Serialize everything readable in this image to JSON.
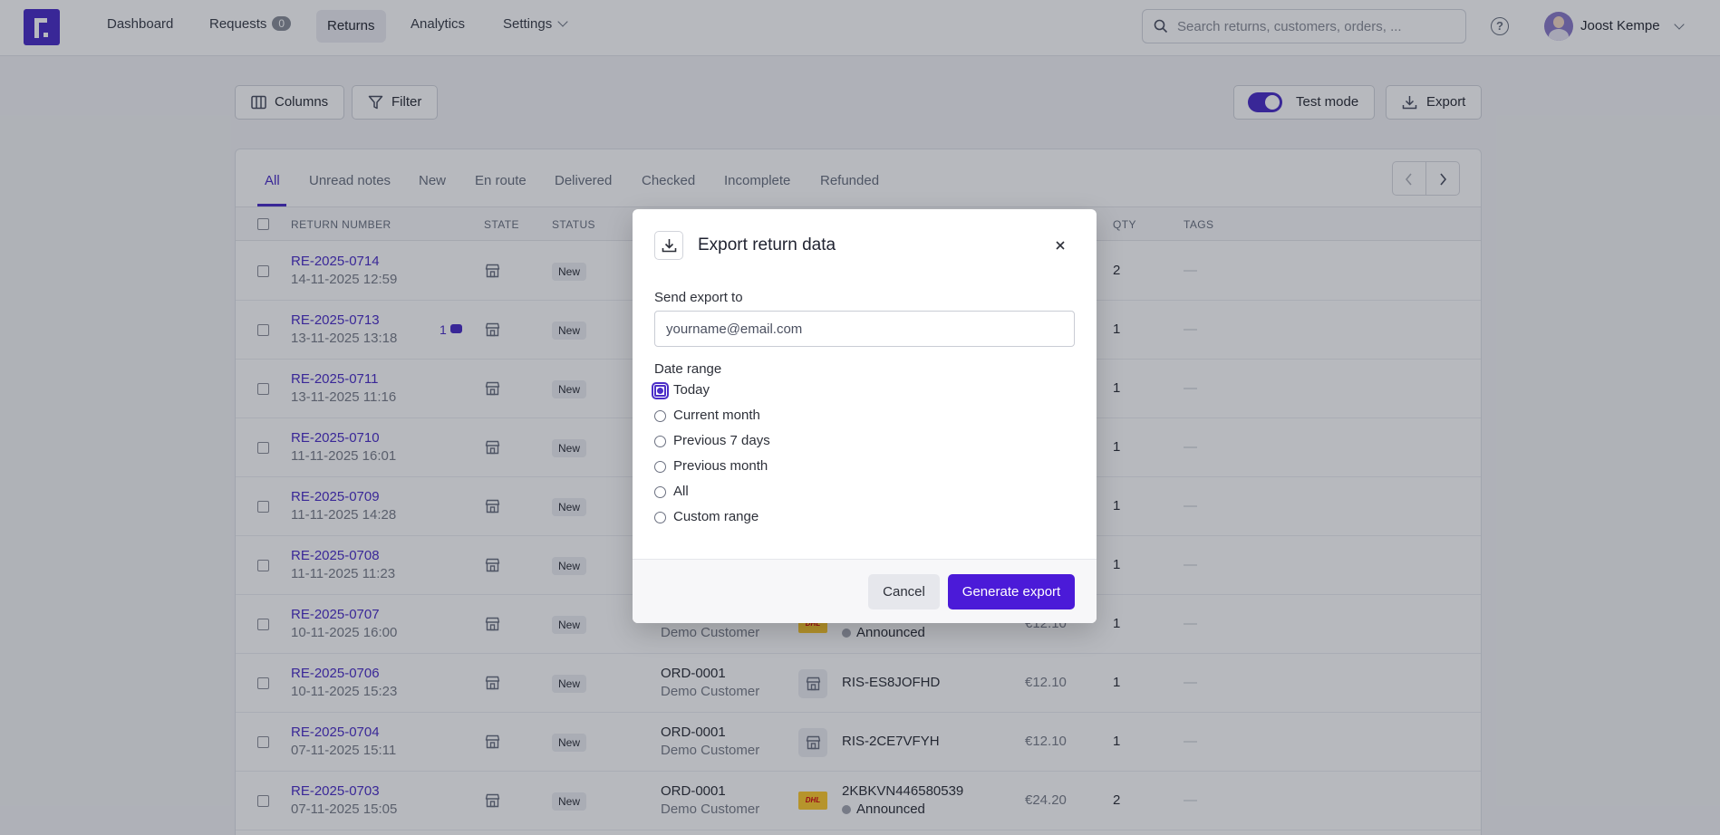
{
  "nav": {
    "items": [
      {
        "label": "Dashboard"
      },
      {
        "label": "Requests",
        "badge": "0"
      },
      {
        "label": "Returns",
        "active": true
      },
      {
        "label": "Analytics"
      },
      {
        "label": "Settings"
      }
    ],
    "search_placeholder": "Search returns, customers, orders, ...",
    "user_name": "Joost Kempe"
  },
  "toolbar": {
    "columns_label": "Columns",
    "filter_label": "Filter",
    "test_mode_label": "Test mode",
    "test_mode_on": true,
    "export_label": "Export"
  },
  "tabs": [
    "All",
    "Unread notes",
    "New",
    "En route",
    "Delivered",
    "Checked",
    "Incomplete",
    "Refunded"
  ],
  "table": {
    "headers": {
      "return_number": "RETURN NUMBER",
      "state": "STATE",
      "status": "STATUS",
      "qty": "QTY",
      "tags": "TAGS"
    },
    "rows": [
      {
        "number": "RE-2025-0714",
        "date": "14-11-2025 12:59",
        "status": "New",
        "qty": "2",
        "tags": "—"
      },
      {
        "number": "RE-2025-0713",
        "date": "13-11-2025 13:18",
        "notes": "1",
        "status": "New",
        "qty": "1",
        "tags": "—"
      },
      {
        "number": "RE-2025-0711",
        "date": "13-11-2025 11:16",
        "status": "New",
        "qty": "1",
        "tags": "—"
      },
      {
        "number": "RE-2025-0710",
        "date": "11-11-2025 16:01",
        "status": "New",
        "qty": "1",
        "tags": "—"
      },
      {
        "number": "RE-2025-0709",
        "date": "11-11-2025 14:28",
        "status": "New",
        "qty": "1",
        "tags": "—"
      },
      {
        "number": "RE-2025-0708",
        "date": "11-11-2025 11:23",
        "status": "New",
        "qty": "1",
        "tags": "—"
      },
      {
        "number": "RE-2025-0707",
        "date": "10-11-2025 16:00",
        "status": "New",
        "customer": "Demo Customer",
        "carrier": "dhl",
        "tracking_status": "Announced",
        "price": "€12.10",
        "qty": "1",
        "tags": "—"
      },
      {
        "number": "RE-2025-0706",
        "date": "10-11-2025 15:23",
        "status": "New",
        "order": "ORD-0001",
        "customer": "Demo Customer",
        "carrier": "store",
        "tracking": "RIS-ES8JOFHD",
        "price": "€12.10",
        "qty": "1",
        "tags": "—"
      },
      {
        "number": "RE-2025-0704",
        "date": "07-11-2025 15:11",
        "status": "New",
        "order": "ORD-0001",
        "customer": "Demo Customer",
        "carrier": "store",
        "tracking": "RIS-2CE7VFYH",
        "price": "€12.10",
        "qty": "1",
        "tags": "—"
      },
      {
        "number": "RE-2025-0703",
        "date": "07-11-2025 15:05",
        "status": "New",
        "order": "ORD-0001",
        "customer": "Demo Customer",
        "carrier": "dhl",
        "tracking": "2KBKVN446580539",
        "tracking_status": "Announced",
        "price": "€24.20",
        "qty": "2",
        "tags": "—"
      }
    ]
  },
  "modal": {
    "title": "Export return data",
    "send_to_label": "Send export to",
    "email_placeholder": "yourname@email.com",
    "date_range_label": "Date range",
    "options": [
      "Today",
      "Current month",
      "Previous 7 days",
      "Previous month",
      "All",
      "Custom range"
    ],
    "selected": "Today",
    "cancel_label": "Cancel",
    "generate_label": "Generate export"
  },
  "colors": {
    "accent": "#4b2ec8",
    "primary_button": "#4b1ad8",
    "dhl_yellow": "#fecb2f"
  }
}
